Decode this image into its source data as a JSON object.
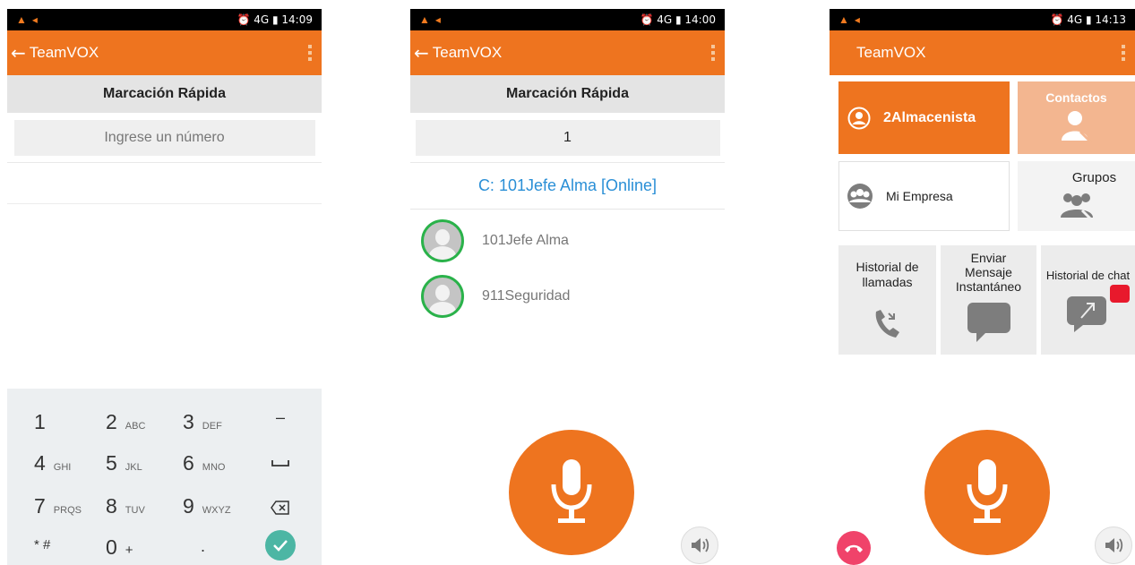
{
  "screen1": {
    "status": {
      "time": "14:09",
      "network": "4G"
    },
    "appbar": {
      "title": "TeamVOX"
    },
    "subheader": "Marcación Rápida",
    "input": {
      "placeholder": "Ingrese un número",
      "value": ""
    },
    "keypad": {
      "keys": [
        {
          "num": "1",
          "letters": ""
        },
        {
          "num": "2",
          "letters": "ABC"
        },
        {
          "num": "3",
          "letters": "DEF"
        },
        {
          "num": "4",
          "letters": "GHI"
        },
        {
          "num": "5",
          "letters": "JKL"
        },
        {
          "num": "6",
          "letters": "MNO"
        },
        {
          "num": "7",
          "letters": "PRQS"
        },
        {
          "num": "8",
          "letters": "TUV"
        },
        {
          "num": "9",
          "letters": "WXYZ"
        },
        {
          "num": "0",
          "letters": "+"
        }
      ],
      "symbols": {
        "star_hash": "* #",
        "dot": ".",
        "dash": "–"
      }
    }
  },
  "screen2": {
    "status": {
      "time": "14:00",
      "network": "4G"
    },
    "appbar": {
      "title": "TeamVOX"
    },
    "subheader": "Marcación Rápida",
    "input": {
      "value": "1"
    },
    "suggestion": "C: 101Jefe Alma [Online]",
    "contacts": [
      {
        "name": "101Jefe Alma"
      },
      {
        "name": "911Seguridad"
      }
    ]
  },
  "screen3": {
    "status": {
      "time": "14:13",
      "network": "4G"
    },
    "appbar": {
      "title": "TeamVOX"
    },
    "tiles": {
      "current_user": "2Almacenista",
      "contacts": "Contactos",
      "company": "Mi Empresa",
      "groups": "Grupos",
      "call_history": "Historial de llamadas",
      "send_message": "Enviar Mensaje Instantáneo",
      "chat_history": "Historial de chat"
    }
  },
  "colors": {
    "accent": "#ee741f",
    "online": "#2ab24a",
    "link": "#2a8fd6",
    "confirm": "#4cb6a4",
    "hangup": "#f0436a",
    "badge": "#e8192c"
  }
}
